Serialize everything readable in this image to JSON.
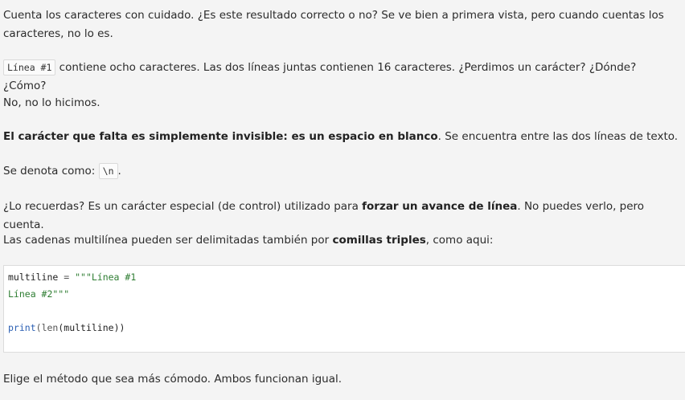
{
  "paragraphs": {
    "p1": "Cuenta los caracteres con cuidado. ¿Es este resultado correcto o no? Se ve bien a primera vista, pero cuando cuentas los caracteres, no lo es.",
    "p2_code": "Línea #1",
    "p2_rest": " contiene ocho caracteres. Las dos líneas juntas contienen 16 caracteres. ¿Perdimos un carácter? ¿Dónde? ¿Cómo?",
    "p3": "No, no lo hicimos.",
    "p4_bold": "El carácter que falta es simplemente invisible: es un espacio en blanco",
    "p4_rest": ". Se encuentra entre las dos líneas de texto.",
    "p5_pre": "Se denota como: ",
    "p5_code": "\\n",
    "p5_post": ".",
    "p6_pre": "¿Lo recuerdas? Es un carácter especial (de control) utilizado para ",
    "p6_bold": "forzar un avance de línea",
    "p6_post": ". No puedes verlo, pero cuenta.",
    "p7_pre": "Las cadenas multilínea pueden ser delimitadas también por ",
    "p7_bold": "comillas triples",
    "p7_post": ", como aqui:",
    "p8": "Elige el método que sea más cómodo. Ambos funcionan igual."
  },
  "code": {
    "l1_var": "multiline",
    "l1_op": " = ",
    "l1_str": "\"\"\"Línea #1",
    "l2_str": "Línea #2\"\"\"",
    "l4_fn": "print",
    "l4_open": "(",
    "l4_builtin": "len",
    "l4_arg": "(multiline))"
  }
}
